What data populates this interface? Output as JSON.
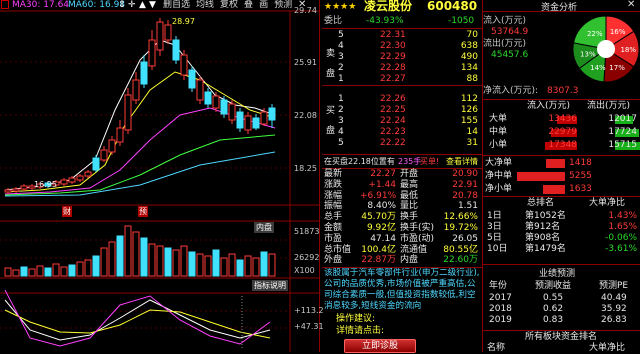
{
  "legend": {
    "ma30": "MA30: 17.64",
    "ma60": "MA60: 16.98"
  },
  "toolbar": [
    "删自选",
    "均线",
    "复权",
    "叠",
    "画",
    "预测"
  ],
  "price_axis": [
    "29.74",
    "25.91",
    "22.08",
    "18.25"
  ],
  "peak_label": "28.97",
  "low_label": "16.95",
  "chart_marks": {
    "cai": "财",
    "fu": "预"
  },
  "volume_tab": "内盘",
  "volume_axis": [
    "51873",
    "26292"
  ],
  "volume_unit": "X100",
  "indicator_tab": "指标说明",
  "indicator_axis": [
    "+113.2",
    "+47.31"
  ],
  "header": {
    "stars": "★★★★",
    "name": "凌云股份",
    "code": "600480"
  },
  "weibi": {
    "label": "委比",
    "pct": "-43.93%",
    "diff": "-1050"
  },
  "sell_label": "卖盘",
  "sell_rows": [
    {
      "n": "5",
      "price": "22.31",
      "vol": "70"
    },
    {
      "n": "4",
      "price": "22.30",
      "vol": "638"
    },
    {
      "n": "3",
      "price": "22.29",
      "vol": "490"
    },
    {
      "n": "2",
      "price": "22.28",
      "vol": "134"
    },
    {
      "n": "1",
      "price": "22.27",
      "vol": "88"
    }
  ],
  "buy_label": "买盘",
  "buy_rows": [
    {
      "n": "1",
      "price": "22.26",
      "vol": "112"
    },
    {
      "n": "2",
      "price": "22.25",
      "vol": "126"
    },
    {
      "n": "3",
      "price": "22.24",
      "vol": "155"
    },
    {
      "n": "4",
      "price": "22.23",
      "vol": "14"
    },
    {
      "n": "5",
      "price": "22.22",
      "vol": "31"
    }
  ],
  "ticker": {
    "text": "在买盘22.18位置有",
    "qty": "235手",
    "action": "买单!",
    "link": "查看详情"
  },
  "stats": [
    {
      "l1": "最新",
      "v1": "22.27",
      "c1": "red",
      "l2": "开盘",
      "v2": "20.90",
      "c2": "red"
    },
    {
      "l1": "涨跌",
      "v1": "+1.44",
      "c1": "red",
      "l2": "最高",
      "v2": "22.91",
      "c2": "red"
    },
    {
      "l1": "涨幅",
      "v1": "+6.91%",
      "c1": "red",
      "l2": "最低",
      "v2": "20.78",
      "c2": "red"
    },
    {
      "l1": "振幅",
      "v1": "8.40%",
      "c1": "wht",
      "l2": "量比",
      "v2": "1.51",
      "c2": "wht"
    },
    {
      "l1": "总手",
      "v1": "45.70万",
      "c1": "yel",
      "l2": "换手",
      "v2": "12.66%",
      "c2": "yel"
    },
    {
      "l1": "金额",
      "v1": "9.92亿",
      "c1": "yel",
      "l2": "换手(实)",
      "v2": "19.72%",
      "c2": "yel"
    },
    {
      "l1": "市盈",
      "v1": "47.14",
      "c1": "wht",
      "l2": "市盈(动)",
      "v2": "26.05",
      "c2": "wht"
    },
    {
      "l1": "总市值",
      "v1": "100.4亿",
      "c1": "yel",
      "l2": "流通值",
      "v2": "80.55亿",
      "c2": "yel"
    },
    {
      "l1": "外盘",
      "v1": "22.87万",
      "c1": "red",
      "l2": "内盘",
      "v2": "22.60万",
      "c2": "grn"
    }
  ],
  "desc": "该股属于汽车零部件行业(申万二级行业),公司的品质优秀,市场价值被严重高估,公司综合素质一般,但值投资指数较低,利空消息较多,短线资金的流向",
  "ops": {
    "advice": "操作建议:",
    "detail": "详情请点击:",
    "btn": "立即诊股"
  },
  "right": {
    "title": "资金分析",
    "pie": [
      {
        "label": "16%",
        "value": 16,
        "color": "#ff3030"
      },
      {
        "label": "18%",
        "value": 18,
        "color": "#e02020"
      },
      {
        "label": "17%",
        "value": 17,
        "color": "#8a0000"
      },
      {
        "label": "14%",
        "value": 14,
        "color": "#20a020"
      },
      {
        "label": "13%",
        "value": 13,
        "color": "#1c8c1c"
      },
      {
        "label": "22%",
        "value": 22,
        "color": "#30c030"
      }
    ],
    "flow": [
      {
        "label": "流入(万元)",
        "value": "53764.9",
        "color": "red"
      },
      {
        "label": "流出(万元)",
        "value": "45457.6",
        "color": "grn"
      },
      {
        "label": "净流入(万元):",
        "value": "8307.3",
        "color": "red"
      }
    ],
    "tbl_head": [
      "流入(万元)",
      "流出(万元)"
    ],
    "tbl": [
      {
        "n": "大单",
        "in": "13436",
        "out": "12017"
      },
      {
        "n": "中单",
        "in": "22979",
        "out": "17724"
      },
      {
        "n": "小单",
        "in": "17348",
        "out": "15715"
      }
    ],
    "net": [
      {
        "n": "大净单",
        "v": "1418",
        "w": 40
      },
      {
        "n": "净中单",
        "v": "5255",
        "w": 100
      },
      {
        "n": "净小单",
        "v": "1633",
        "w": 45
      }
    ],
    "rank_head": [
      "总排名",
      "大单净比"
    ],
    "rank": [
      {
        "d": "1日",
        "r": "第1052名",
        "p": "1.43%",
        "c": "red"
      },
      {
        "d": "3日",
        "r": "第912名",
        "p": "1.65%",
        "c": "red"
      },
      {
        "d": "5日",
        "r": "第908名",
        "p": "-0.06%",
        "c": "grn"
      },
      {
        "d": "10日",
        "r": "第1479名",
        "p": "-3.61%",
        "c": "grn"
      }
    ],
    "forecast_title": "业绩预测",
    "forecast_head": [
      "年份",
      "预测收益",
      "预测PE"
    ],
    "forecast": [
      {
        "y": "2017",
        "e": "0.55",
        "pe": "40.49"
      },
      {
        "y": "2018",
        "e": "0.62",
        "pe": "35.92"
      },
      {
        "y": "2019",
        "e": "0.83",
        "pe": "26.83"
      }
    ],
    "fund_title": "所有板块资金排名",
    "fund_head": [
      "名称",
      "大单净比"
    ]
  }
}
